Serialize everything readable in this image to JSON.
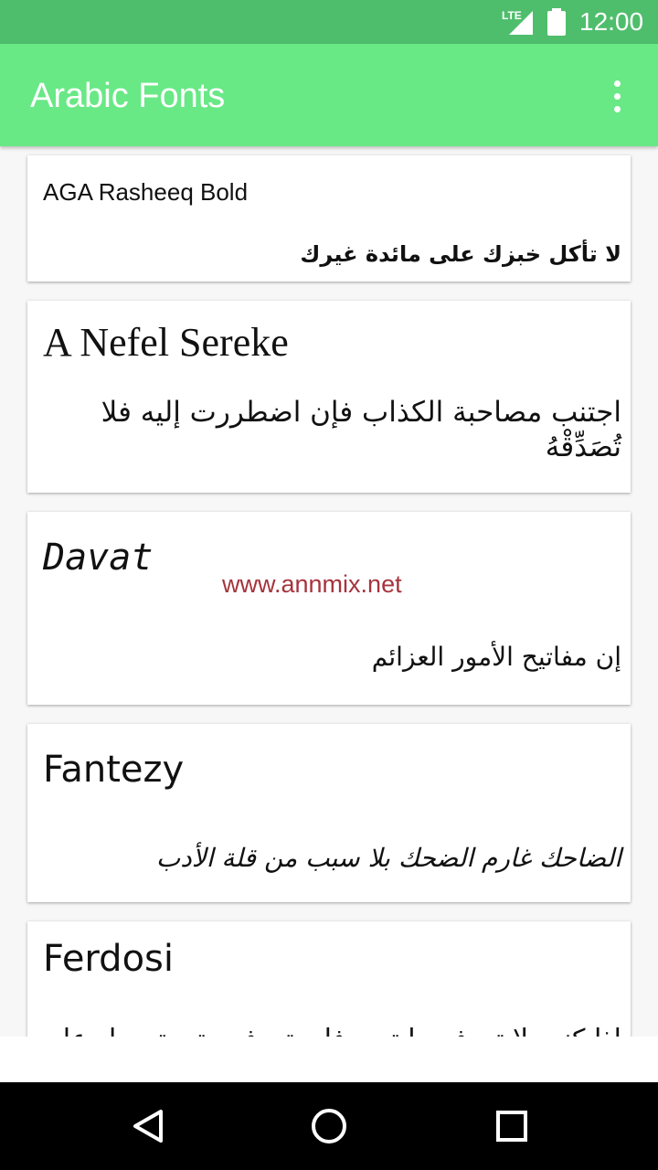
{
  "status_bar": {
    "network": "LTE",
    "time": "12:00"
  },
  "app_bar": {
    "title": "Arabic Fonts",
    "menu_icon": "more-vert-icon"
  },
  "fonts": [
    {
      "name": "AGA Rasheeq Bold",
      "sample": "لا تأكل خبزك على مائدة غيرك"
    },
    {
      "name": "A Nefel Sereke",
      "sample": "اجتنب مصاحبة الكذاب فإن اضطررت إليه فلا تُصَدِّقْهُ"
    },
    {
      "name": "Davat",
      "sample": "إن مفاتيح الأمور العزائم"
    },
    {
      "name": "Fantezy",
      "sample": "الضاحك غارم الضحك بلا سبب من قلة الأدب"
    },
    {
      "name": "Ferdosi",
      "sample": "إذا كنت لا تعرف ما تريد فلن تعرف متى تحصل عليه"
    }
  ],
  "watermark": "www.annmix.net",
  "nav_bar": {
    "back": "back-icon",
    "home": "home-icon",
    "recents": "recents-icon"
  }
}
